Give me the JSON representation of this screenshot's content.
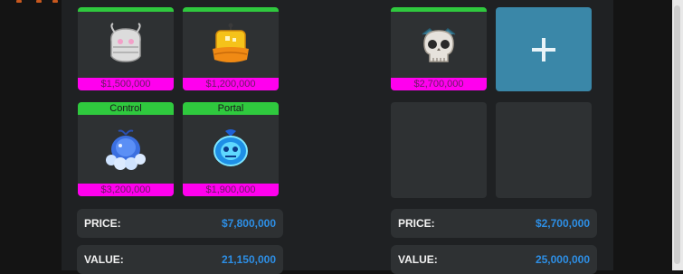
{
  "left_trade": {
    "items": [
      {
        "category": "",
        "price": "$1,500,000",
        "icon": "ghost-fruit-icon"
      },
      {
        "category": "",
        "price": "$1,200,000",
        "icon": "gold-block-fruit-icon"
      },
      {
        "category": "Control",
        "price": "$3,200,000",
        "icon": "control-fruit-icon"
      },
      {
        "category": "Portal",
        "price": "$1,900,000",
        "icon": "portal-fruit-icon"
      }
    ],
    "price_label": "PRICE:",
    "price_value": "$7,800,000",
    "value_label": "VALUE:",
    "value_value": "21,150,000"
  },
  "right_trade": {
    "items": [
      {
        "category": "",
        "price": "$2,700,000",
        "icon": "skull-fruit-icon"
      }
    ],
    "add_button_icon": "plus-icon",
    "price_label": "PRICE:",
    "price_value": "$2,700,000",
    "value_label": "VALUE:",
    "value_value": "25,000,000"
  },
  "colors": {
    "category_tag": "#2fc93e",
    "price_tag": "#ff00ee",
    "stat_value": "#2d8fe6",
    "add_button": "#3a87a8"
  }
}
